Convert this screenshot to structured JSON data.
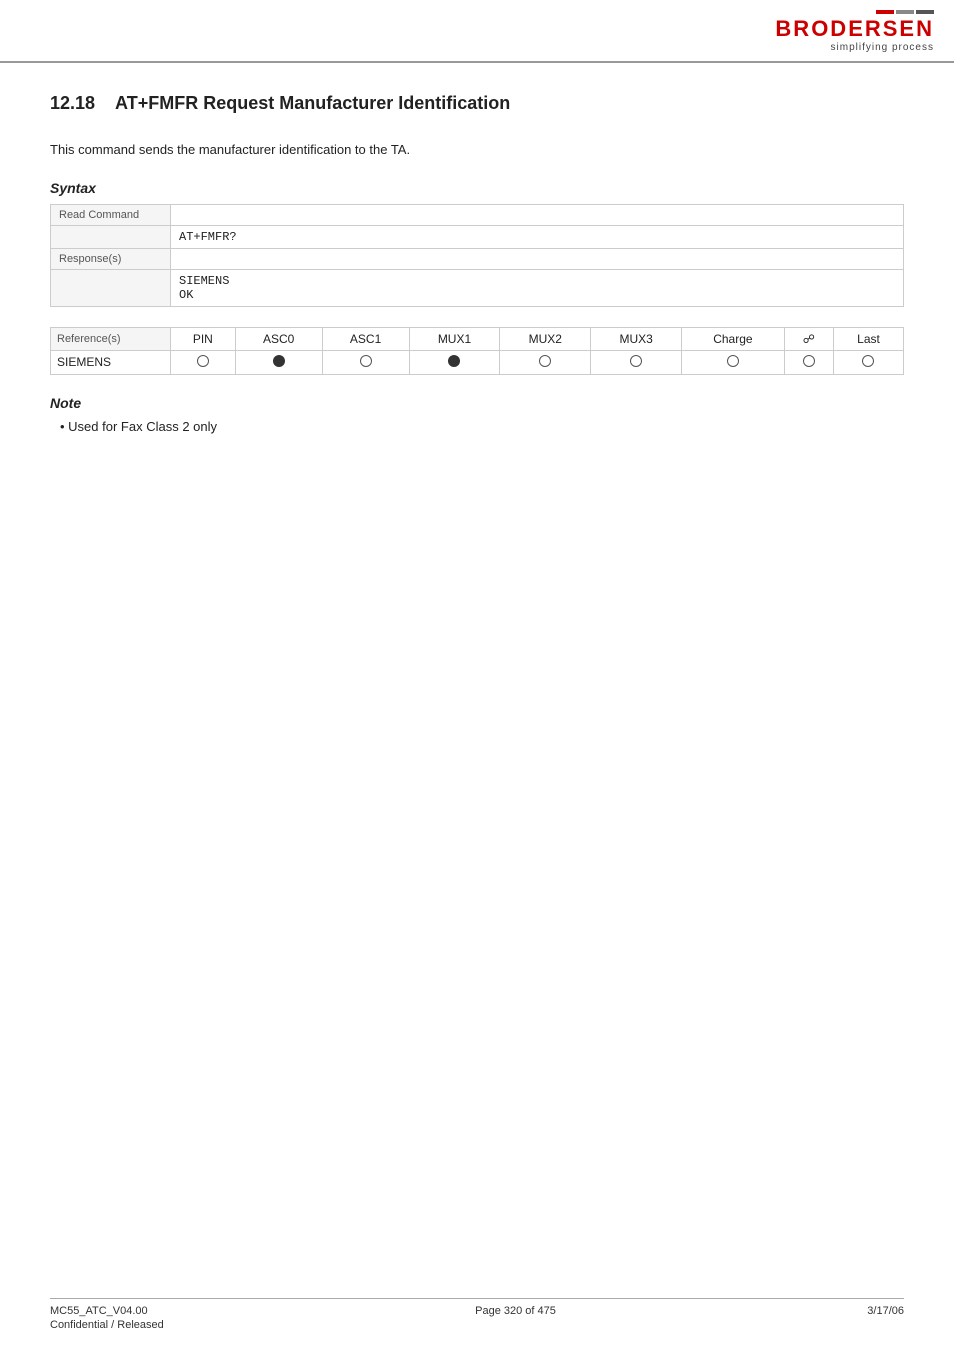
{
  "header": {
    "logo_text": "BRODERSEN",
    "logo_tagline": "simplifying process"
  },
  "section": {
    "number": "12.18",
    "title": "AT+FMFR   Request Manufacturer Identification",
    "description": "This command sends the manufacturer identification to the TA."
  },
  "syntax": {
    "heading": "Syntax",
    "read_command_label": "Read Command",
    "read_command_value": "AT+FMFR?",
    "responses_label": "Response(s)",
    "responses_value": "SIEMENS\nOK",
    "references_label": "Reference(s)",
    "columns": [
      "PIN",
      "ASC0",
      "ASC1",
      "MUX1",
      "MUX2",
      "MUX3",
      "Charge",
      "⚡",
      "Last"
    ],
    "rows": [
      {
        "label": "SIEMENS",
        "values": [
          "empty",
          "filled",
          "empty",
          "filled",
          "empty",
          "empty",
          "empty",
          "empty",
          "empty"
        ]
      }
    ]
  },
  "note": {
    "heading": "Note",
    "items": [
      "Used for Fax Class 2 only"
    ]
  },
  "footer": {
    "left_line1": "MC55_ATC_V04.00",
    "left_line2": "Confidential / Released",
    "center": "Page 320 of 475",
    "right": "3/17/06"
  }
}
